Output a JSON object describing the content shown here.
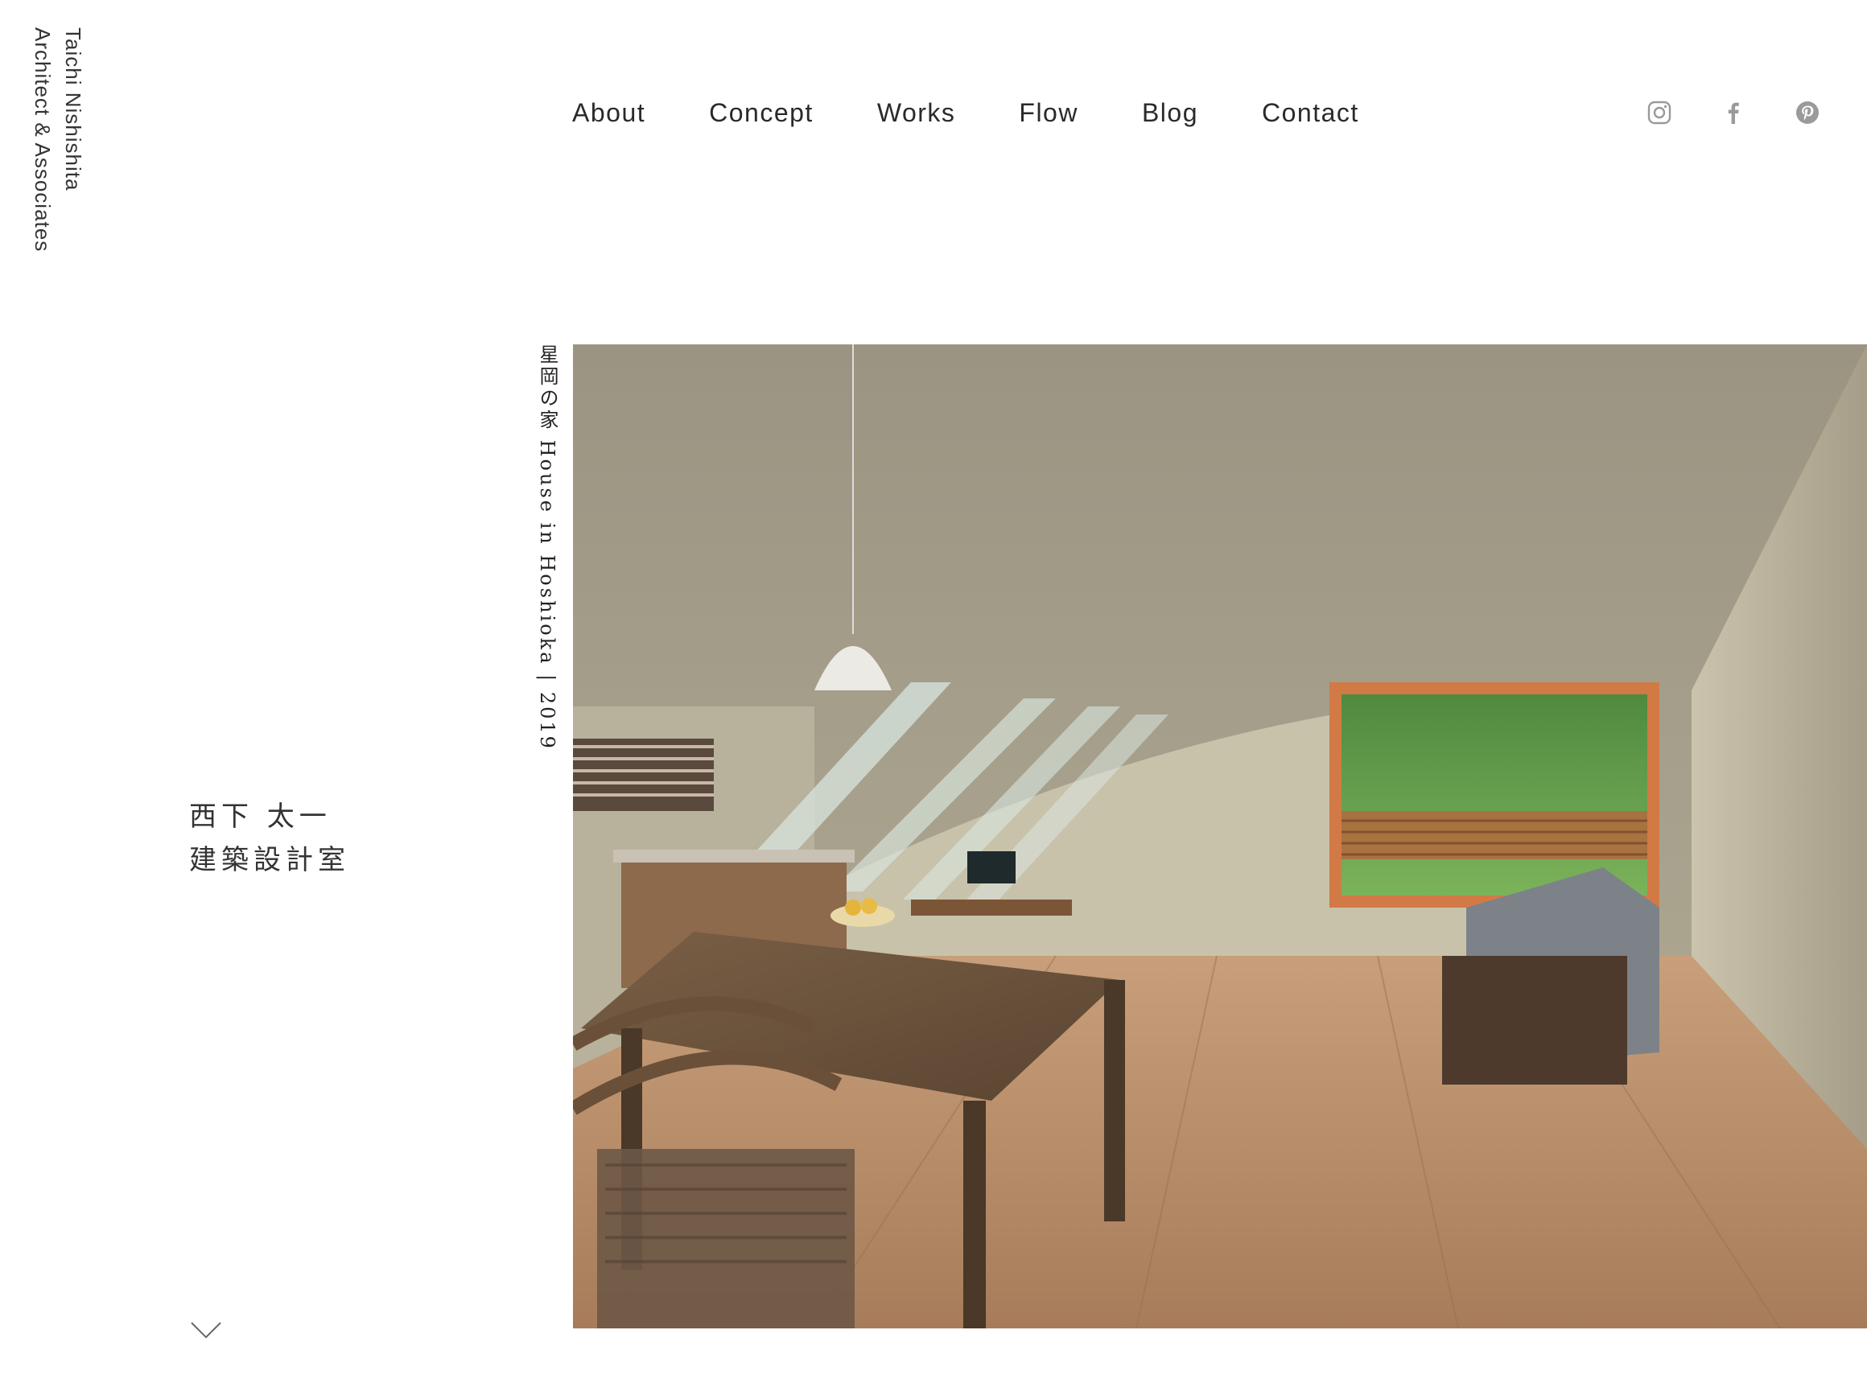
{
  "logo": {
    "line1": "Taichi Nishishita",
    "line2": "Architect & Associates"
  },
  "nav": {
    "items": [
      "About",
      "Concept",
      "Works",
      "Flow",
      "Blog",
      "Contact"
    ]
  },
  "social": {
    "icons": [
      "instagram-icon",
      "facebook-icon",
      "pinterest-icon"
    ],
    "color": "#9a9a9a"
  },
  "hero": {
    "caption": "星岡の家 House in Hoshioka | 2019"
  },
  "studio": {
    "name_line1": "西下 太一",
    "name_line2": "建築設計室"
  },
  "scroll": {
    "icon": "chevron-down-icon"
  }
}
